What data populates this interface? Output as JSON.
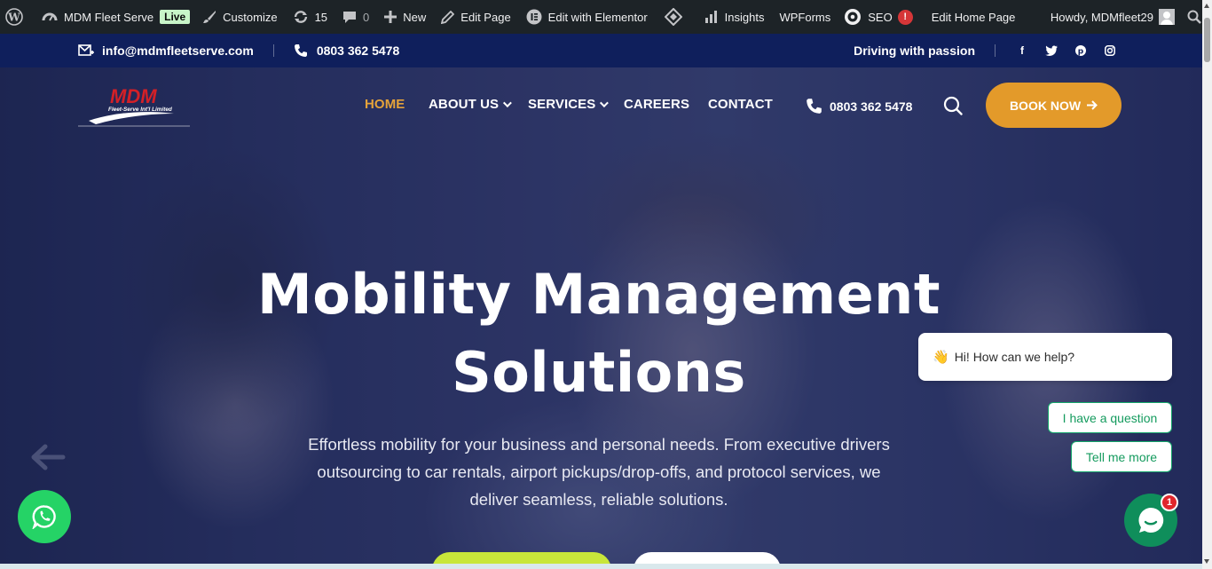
{
  "admin_bar": {
    "site_name": "MDM Fleet Serve",
    "live_label": "Live",
    "customize": "Customize",
    "updates_count": "15",
    "comments_count": "0",
    "new_label": "New",
    "edit_page": "Edit Page",
    "edit_elementor": "Edit with Elementor",
    "insights": "Insights",
    "wpforms": "WPForms",
    "seo": "SEO",
    "seo_badge": "!",
    "edit_home": "Edit Home Page",
    "howdy": "Howdy, MDMfleet29"
  },
  "topbar": {
    "email": "info@mdmfleetserve.com",
    "phone": "0803 362 5478",
    "tagline": "Driving with passion",
    "social": [
      "facebook-icon",
      "twitter-icon",
      "pinterest-icon",
      "instagram-icon"
    ]
  },
  "logo": {
    "name": "MDM",
    "sub": "Fleet-Serve Int'l Limited"
  },
  "nav": {
    "home": "HOME",
    "about": "ABOUT US",
    "services": "SERVICES",
    "careers": "CAREERS",
    "contact": "CONTACT",
    "phone": "0803 362 5478",
    "book": "BOOK NOW"
  },
  "hero": {
    "title_line1": "Mobility Management",
    "title_line2": "Solutions",
    "text": "Effortless mobility for your business and personal needs. From executive drivers outsourcing to car rentals, airport pickups/drop-offs, and protocol services, we deliver seamless, reliable solutions."
  },
  "chat": {
    "greeting": "Hi! How can we help?",
    "option1": "I have a question",
    "option2": "Tell me more",
    "unread": "1"
  },
  "colors": {
    "accent": "#e39a2a",
    "active_nav": "#e5a33a",
    "topbar": "#0f1f5c",
    "admin_bar": "#1d2327",
    "whatsapp": "#25d366",
    "chat_green": "#0f8e5b",
    "cta_green": "#c8e63a"
  }
}
